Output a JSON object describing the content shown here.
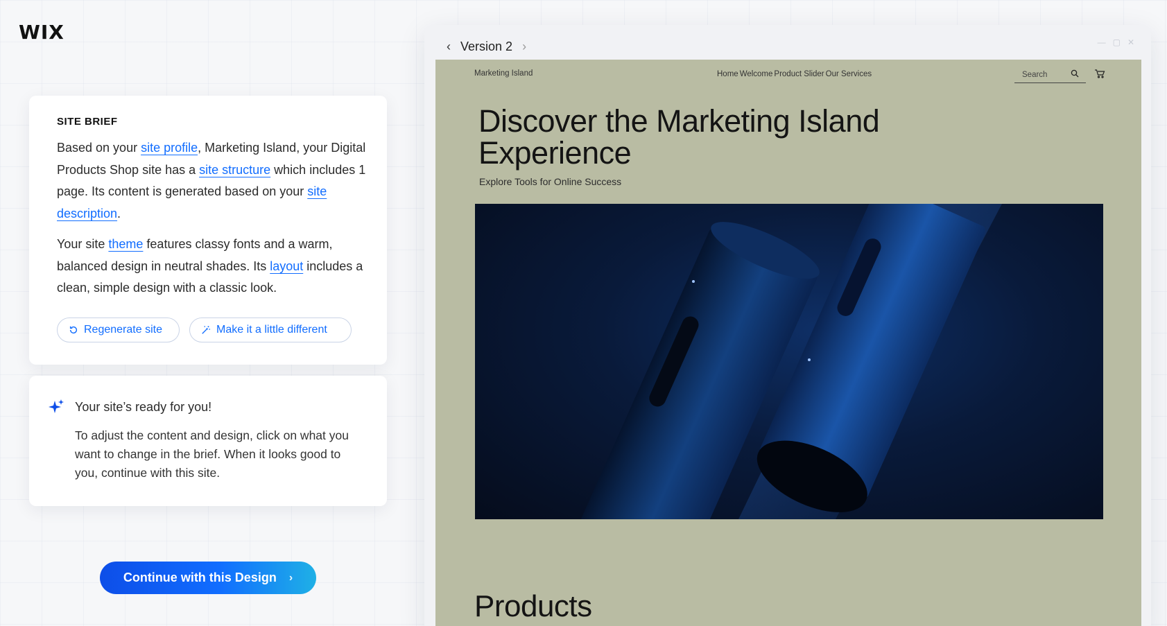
{
  "brand": {
    "logo": "WIX"
  },
  "brief": {
    "title": "SITE BRIEF",
    "p1": {
      "t1": "Based on your ",
      "link_profile": "site profile",
      "t2": ", Marketing Island, your Digital Products Shop site has a ",
      "link_structure": "site structure",
      "t3": " which includes 1 page. Its content is generated based on your ",
      "link_description": "site description",
      "t4": "."
    },
    "p2": {
      "t1": "Your site ",
      "link_theme": "theme",
      "t2": " features classy fonts and a warm, balanced design in neutral shades. Its ",
      "link_layout": "layout",
      "t3": " includes a clean, simple design with a classic look."
    },
    "regenerate_label": "Regenerate site",
    "different_label": "Make it a little different"
  },
  "ready": {
    "title": "Your site’s ready for you!",
    "body": "To adjust the content and design, click on what you want to change in the brief. When it looks good to you, continue with this site."
  },
  "continue_label": "Continue with this Design",
  "preview": {
    "version_label": "Version 2",
    "site": {
      "brand": "Marketing Island",
      "menu": [
        "Home",
        "Welcome",
        "Product Slider",
        "Our Services"
      ],
      "search_placeholder": "Search",
      "hero_title": "Discover the Marketing Island Experience",
      "hero_subtitle": "Explore Tools for Online Success",
      "products_heading": "Products"
    }
  },
  "colors": {
    "accent": "#116dff",
    "site_bg": "#b9bca3",
    "hero_image_bg": "#0a1a3a"
  }
}
